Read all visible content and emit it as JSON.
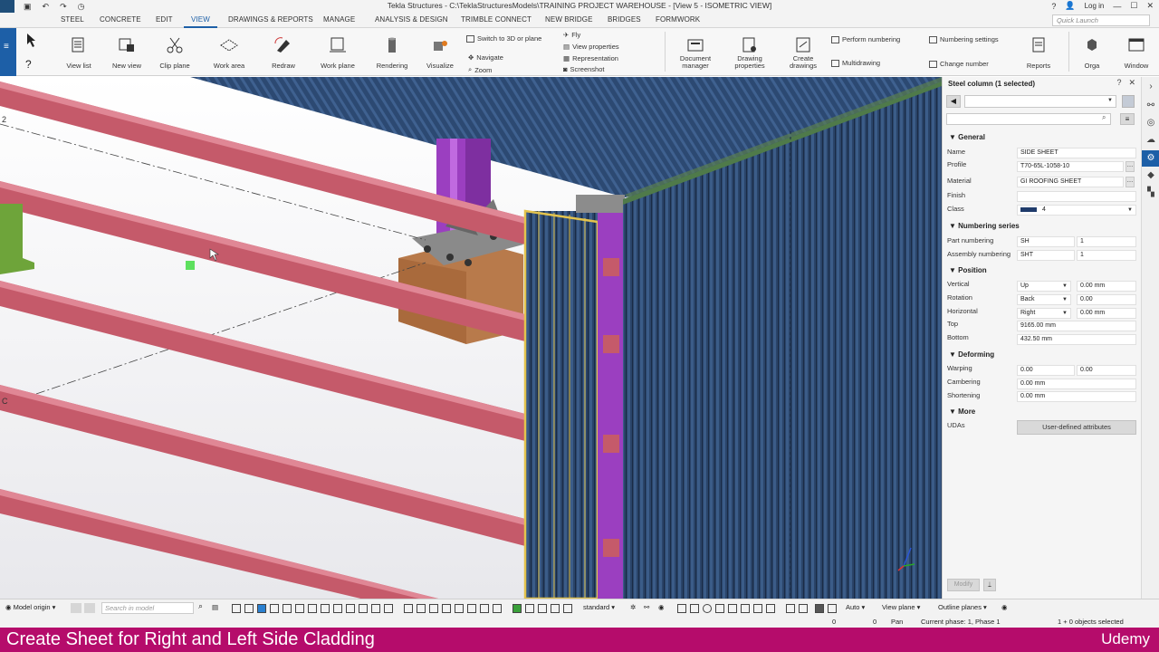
{
  "window": {
    "title": "Tekla Structures - C:\\TeklaStructuresModels\\TRAINING PROJECT WAREHOUSE - [View 5 - ISOMETRIC VIEW]",
    "login": "Log in"
  },
  "menu": {
    "tabs": [
      "STEEL",
      "CONCRETE",
      "EDIT",
      "VIEW",
      "DRAWINGS & REPORTS",
      "MANAGE",
      "ANALYSIS & DESIGN",
      "TRIMBLE CONNECT",
      "NEW BRIDGE",
      "BRIDGES",
      "FORMWORK"
    ],
    "active_tab": "VIEW",
    "quick_launch_placeholder": "Quick Launch"
  },
  "ribbon": {
    "view_list": "View list",
    "new_view": "New view",
    "clip_plane": "Clip plane",
    "work_area": "Work area",
    "redraw": "Redraw",
    "work_plane": "Work plane",
    "rendering": "Rendering",
    "visualize": "Visualize",
    "switch_3d": "Switch to 3D or plane",
    "navigate": "Navigate",
    "zoom": "Zoom",
    "fly": "Fly",
    "view_properties": "View properties",
    "representation": "Representation",
    "screenshot": "Screenshot",
    "document_manager": "Document manager",
    "drawing_properties": "Drawing properties",
    "create_drawings": "Create drawings",
    "perform_numbering": "Perform numbering",
    "numbering_settings": "Numbering settings",
    "multidrawing": "Multidrawing",
    "change_number": "Change number",
    "reports": "Reports",
    "orga": "Orga",
    "window": "Window"
  },
  "viewport": {
    "grid_labels": {
      "two": "2",
      "c": "C"
    }
  },
  "panel": {
    "header": "Steel column (1 selected)",
    "sections": {
      "general": "General",
      "numbering": "Numbering series",
      "position": "Position",
      "deforming": "Deforming",
      "more": "More"
    },
    "labels": {
      "name": "Name",
      "profile": "Profile",
      "material": "Material",
      "finish": "Finish",
      "class": "Class",
      "part_numbering": "Part numbering",
      "assembly_numbering": "Assembly numbering",
      "vertical": "Vertical",
      "rotation": "Rotation",
      "horizontal": "Horizontal",
      "top": "Top",
      "bottom": "Bottom",
      "warping": "Warping",
      "cambering": "Cambering",
      "shortening": "Shortening",
      "udas": "UDAs"
    },
    "values": {
      "name": "SIDE SHEET",
      "profile": "T70-65L-1058-10",
      "material": "GI ROOFING SHEET",
      "finish": "",
      "class": "4",
      "part_prefix": "SH",
      "part_start": "1",
      "assembly_prefix": "SHT",
      "assembly_start": "1",
      "vertical": "Up",
      "vertical_offset": "0.00 mm",
      "rotation": "Back",
      "rotation_offset": "0.00",
      "horizontal": "Right",
      "horizontal_offset": "0.00 mm",
      "top": "9165.00 mm",
      "bottom": "432.50 mm",
      "warping_1": "0.00",
      "warping_2": "0.00",
      "cambering": "0.00 mm",
      "shortening": "0.00 mm"
    },
    "uda_button": "User-defined attributes",
    "modify_button": "Modify"
  },
  "bottombar": {
    "model_origin": "Model origin",
    "search_placeholder": "Search in model",
    "standard": "standard",
    "auto": "Auto",
    "view_plane": "View plane",
    "outline_planes": "Outline planes"
  },
  "status": {
    "x": "0",
    "y": "0",
    "pan": "Pan",
    "phase": "Current phase: 1, Phase 1",
    "selected": "1 + 0 objects selected"
  },
  "caption": {
    "text": "Create Sheet for Right and Left Side Cladding",
    "brand": "Udemy"
  },
  "colors": {
    "accent": "#1d5fa7",
    "caption_bg": "#b50c6b",
    "purlin": "#c55a6a",
    "roof_sheet": "#2d4a72",
    "column": "#9b3fc0",
    "selected_sheet": "#e3c34d",
    "base_block": "#b87a4b"
  }
}
